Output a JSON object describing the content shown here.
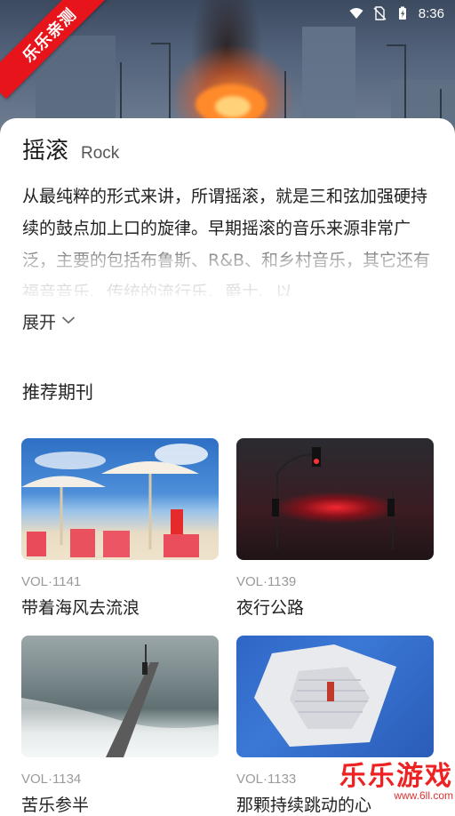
{
  "status_bar": {
    "time": "8:36"
  },
  "ribbon": {
    "label": "乐乐亲测"
  },
  "genre": {
    "title": "摇滚",
    "subtitle": "Rock",
    "description": "从最纯粹的形式来讲，所谓摇滚，就是三和弦加强硬持续的鼓点加上口的旋律。早期摇滚的音乐来源非常广泛，主要的包括布鲁斯、R&B、和乡村音乐，其它还有福音音乐、传统的流行乐、爵士、以",
    "expand_label": "展开"
  },
  "recommended": {
    "section_title": "推荐期刊",
    "items": [
      {
        "vol": "VOL·1141",
        "name": "带着海风去流浪"
      },
      {
        "vol": "VOL·1139",
        "name": "夜行公路"
      },
      {
        "vol": "VOL·1134",
        "name": "苦乐参半"
      },
      {
        "vol": "VOL·1133",
        "name": "那颗持续跳动的心"
      }
    ]
  },
  "watermark": {
    "title": "乐乐游戏",
    "url": "www.6ll.com"
  },
  "colors": {
    "ribbon": "#e7151b",
    "vol_text": "#9a9a9a"
  }
}
